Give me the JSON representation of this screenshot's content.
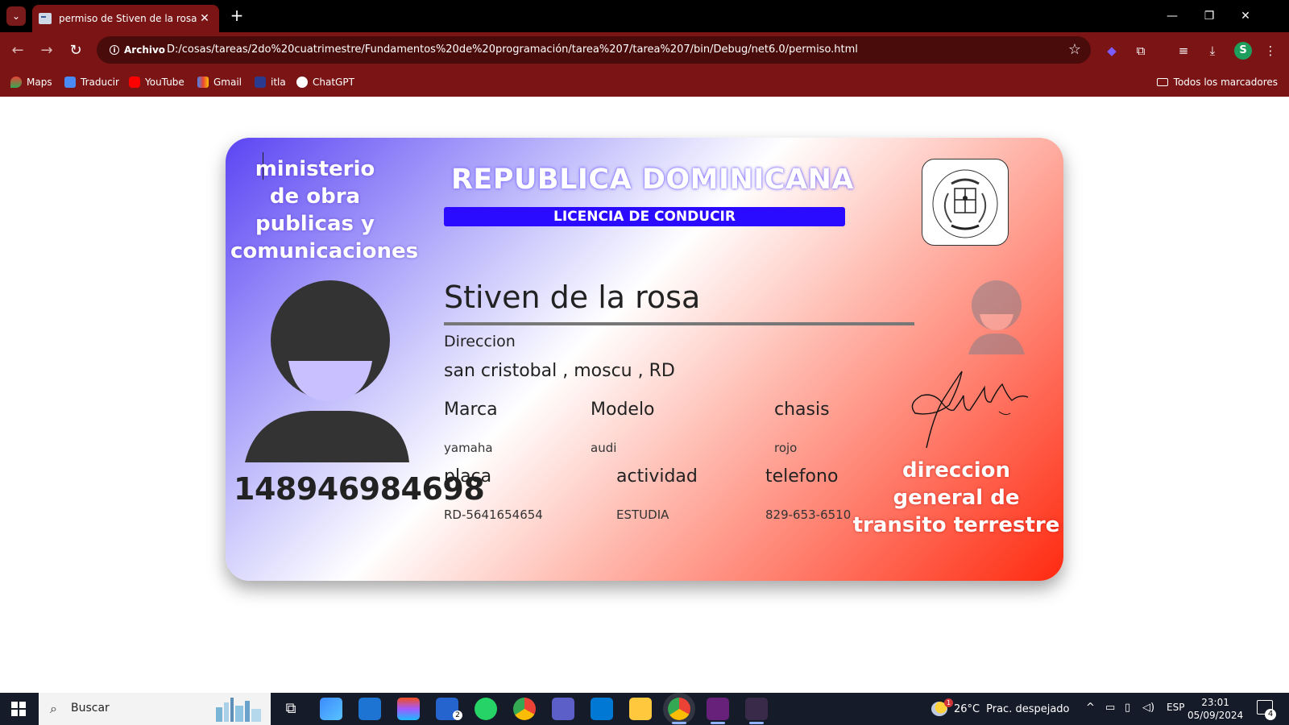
{
  "browser": {
    "tab_title": "permiso de Stiven de la rosa",
    "site_info_label": "Archivo",
    "url": "D:/cosas/tareas/2do%20cuatrimestre/Fundamentos%20de%20programación/tarea%207/tarea%207/bin/Debug/net6.0/permiso.html",
    "profile_initial": "S",
    "bookmarks": [
      "Maps",
      "Traducir",
      "YouTube",
      "Gmail",
      "itla",
      "ChatGPT"
    ],
    "all_bookmarks_label": "Todos los marcadores",
    "theme_color": "#7b1515"
  },
  "card": {
    "ministry": [
      "ministerio",
      "de obra",
      "publicas y",
      "comunicaciones"
    ],
    "country": "REPUBLICA DOMINICANA",
    "license_title": "LICENCIA DE CONDUCIR",
    "name": "Stiven de la rosa",
    "id_number": "148946984698",
    "address_label": "Direccion",
    "address_value": "san cristobal , moscu , RD",
    "fields": {
      "marca_label": "Marca",
      "marca_value": "yamaha",
      "modelo_label": "Modelo",
      "modelo_value": "audi",
      "chasis_label": "chasis",
      "chasis_value": "rojo",
      "placa_label": "placa",
      "placa_value": "RD-5641654654",
      "actividad_label": "actividad",
      "actividad_value": "ESTUDIA",
      "telefono_label": "telefono",
      "telefono_value": "829-653-6510"
    },
    "issuer": [
      "direccion",
      "general de",
      "transito terrestre"
    ],
    "colors": {
      "blue": "#2b0bff",
      "red": "#ff2a10"
    }
  },
  "taskbar": {
    "search_placeholder": "Buscar",
    "weather_temp": "26°C",
    "weather_desc": "Prac. despejado",
    "language": "ESP",
    "time": "23:01",
    "date": "05/09/2024",
    "notification_count": "4",
    "todo_badge": "2",
    "weather_badge": "1"
  }
}
